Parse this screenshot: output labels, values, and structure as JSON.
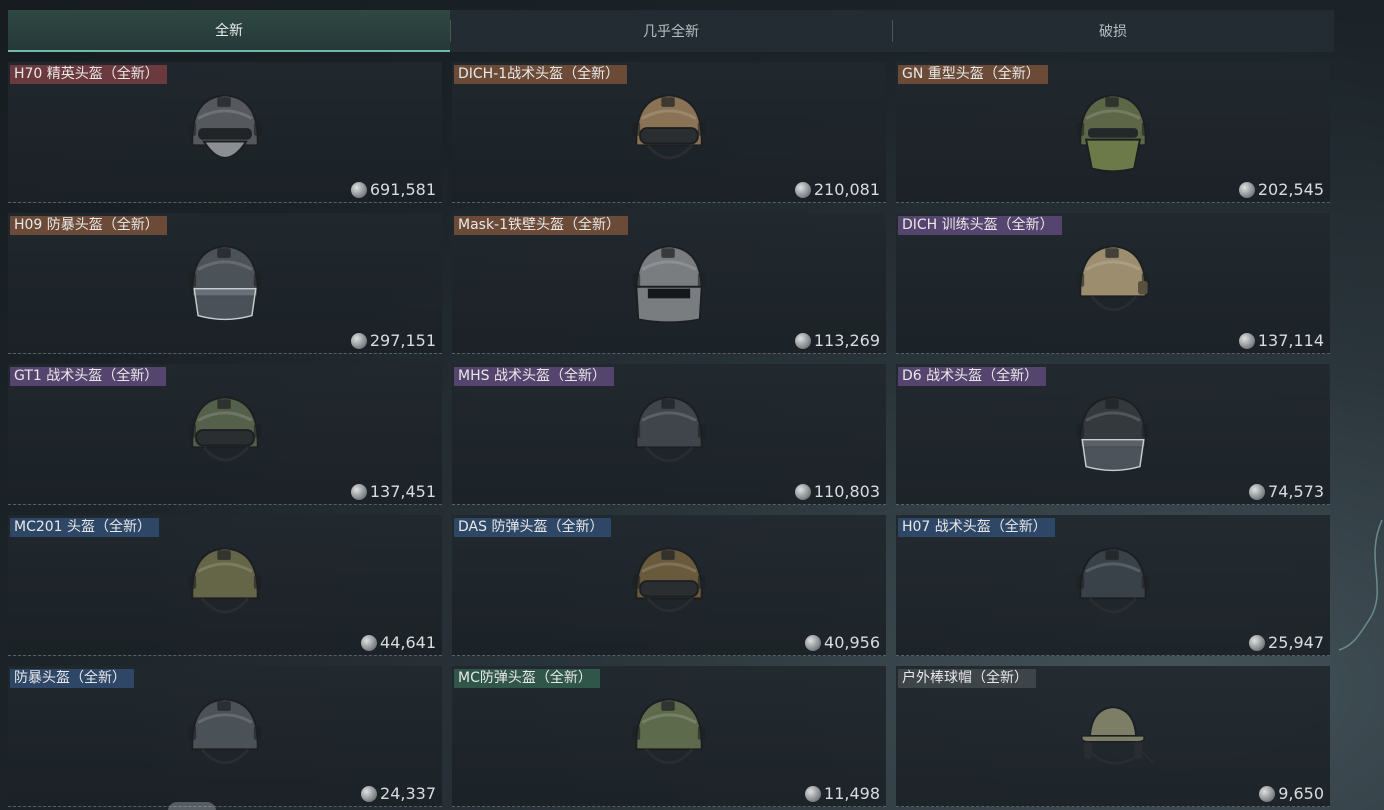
{
  "tabs": [
    {
      "label": "全新",
      "active": true
    },
    {
      "label": "几乎全新",
      "active": false
    },
    {
      "label": "破损",
      "active": false
    }
  ],
  "items": [
    {
      "name": "H70 精英头盔（全新）",
      "price": "691,581",
      "tag_color": "#6b3a3e",
      "helmet_color": "#55595e",
      "helmet_icon": "helmet-icon-masked"
    },
    {
      "name": "DICH-1战术头盔（全新）",
      "price": "210,081",
      "tag_color": "#6b4b38",
      "helmet_color": "#8a7355",
      "helmet_icon": "helmet-icon-goggles"
    },
    {
      "name": "GN 重型头盔（全新）",
      "price": "202,545",
      "tag_color": "#6b4b38",
      "helmet_color": "#5d6646",
      "helmet_icon": "helmet-icon-heavy"
    },
    {
      "name": "H09 防暴头盔（全新）",
      "price": "297,151",
      "tag_color": "#6b4b38",
      "helmet_color": "#4b5258",
      "helmet_icon": "helmet-icon-visor"
    },
    {
      "name": "Mask-1铁壁头盔（全新）",
      "price": "113,269",
      "tag_color": "#6b4b38",
      "helmet_color": "#7a7d7f",
      "helmet_icon": "helmet-icon-mask"
    },
    {
      "name": "DICH 训练头盔（全新）",
      "price": "137,114",
      "tag_color": "#55456e",
      "helmet_color": "#9b8d6e",
      "helmet_icon": "helmet-icon-training"
    },
    {
      "name": "GT1 战术头盔（全新）",
      "price": "137,451",
      "tag_color": "#55456e",
      "helmet_color": "#55604a",
      "helmet_icon": "helmet-icon-goggles"
    },
    {
      "name": "MHS 战术头盔（全新）",
      "price": "110,803",
      "tag_color": "#55456e",
      "helmet_color": "#3f454b",
      "helmet_icon": "helmet-icon-tactical"
    },
    {
      "name": "D6 战术头盔（全新）",
      "price": "74,573",
      "tag_color": "#55456e",
      "helmet_color": "#34393d",
      "helmet_icon": "helmet-icon-visor"
    },
    {
      "name": "MC201 头盔（全新）",
      "price": "44,641",
      "tag_color": "#2e4766",
      "helmet_color": "#656647",
      "helmet_icon": "helmet-icon-tactical"
    },
    {
      "name": "DAS 防弹头盔（全新）",
      "price": "40,956",
      "tag_color": "#2e4766",
      "helmet_color": "#6a5a3c",
      "helmet_icon": "helmet-icon-goggles"
    },
    {
      "name": "H07 战术头盔（全新）",
      "price": "25,947",
      "tag_color": "#2e4766",
      "helmet_color": "#3a4249",
      "helmet_icon": "helmet-icon-tactical"
    },
    {
      "name": "防暴头盔（全新）",
      "price": "24,337",
      "tag_color": "#2e4766",
      "helmet_color": "#4a5157",
      "helmet_icon": "helmet-icon-round"
    },
    {
      "name": "MC防弹头盔（全新）",
      "price": "11,498",
      "tag_color": "#2f5648",
      "helmet_color": "#5e6a4c",
      "helmet_icon": "helmet-icon-round"
    },
    {
      "name": "户外棒球帽（全新）",
      "price": "9,650",
      "tag_color": "#3e4549",
      "helmet_color": "#7c7e66",
      "helmet_icon": "cap-icon"
    }
  ]
}
